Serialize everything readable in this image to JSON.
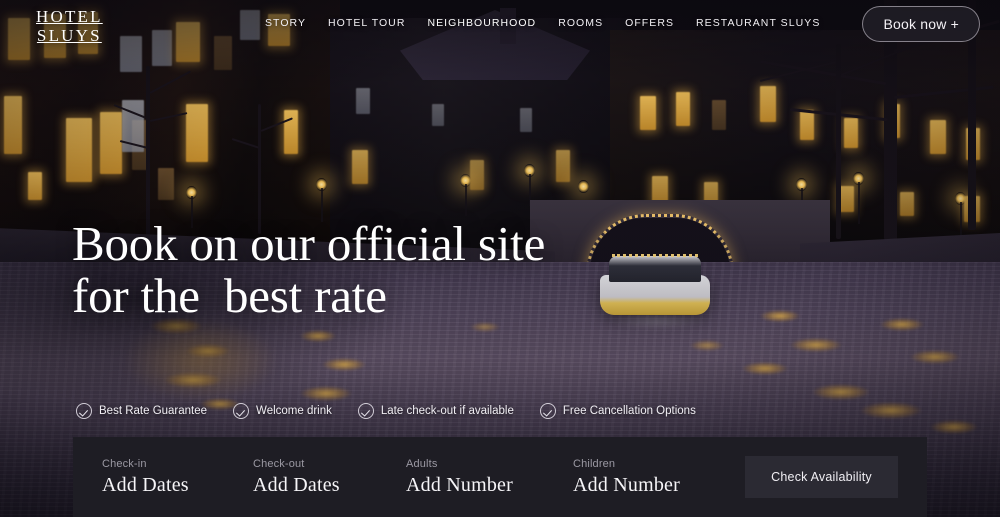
{
  "header": {
    "logo": {
      "line1": "HOTEL",
      "line2": "SLUYS"
    },
    "nav": [
      {
        "label": "STORY",
        "active": false
      },
      {
        "label": "HOTEL TOUR",
        "active": false
      },
      {
        "label": "NEIGHBOURHOOD",
        "active": true
      },
      {
        "label": "ROOMS",
        "active": false
      },
      {
        "label": "OFFERS",
        "active": false
      },
      {
        "label": "RESTAURANT SLUYS",
        "active": false
      }
    ],
    "book_now_label": "Book now +"
  },
  "hero": {
    "headline_line1": "Book on our official site",
    "headline_line2": "for the  best rate"
  },
  "perks": [
    {
      "icon": "check-circle-icon",
      "label": "Best Rate Guarantee"
    },
    {
      "icon": "check-circle-icon",
      "label": "Welcome drink"
    },
    {
      "icon": "check-circle-icon",
      "label": "Late check-out if available"
    },
    {
      "icon": "check-circle-icon",
      "label": "Free Cancellation Options"
    }
  ],
  "booking_bar": {
    "fields": [
      {
        "label": "Check-in",
        "value": "Add Dates"
      },
      {
        "label": "Check-out",
        "value": "Add Dates"
      },
      {
        "label": "Adults",
        "value": "Add Number"
      },
      {
        "label": "Children",
        "value": "Add Number"
      }
    ],
    "submit_label": "Check Availability"
  },
  "colors": {
    "bar_background": "#1e1d24",
    "submit_background": "#2b2a33",
    "text_primary": "#f6f5f8",
    "text_muted": "#9b99a3",
    "sky": "#bf99ad",
    "window_light": "#f3c25a"
  },
  "background_image": {
    "scene": "amsterdam-canal-at-dusk",
    "elements": [
      "canal-houses",
      "street-lamps",
      "bare-trees",
      "illuminated-bridge",
      "canal-boat",
      "water-reflections"
    ]
  }
}
